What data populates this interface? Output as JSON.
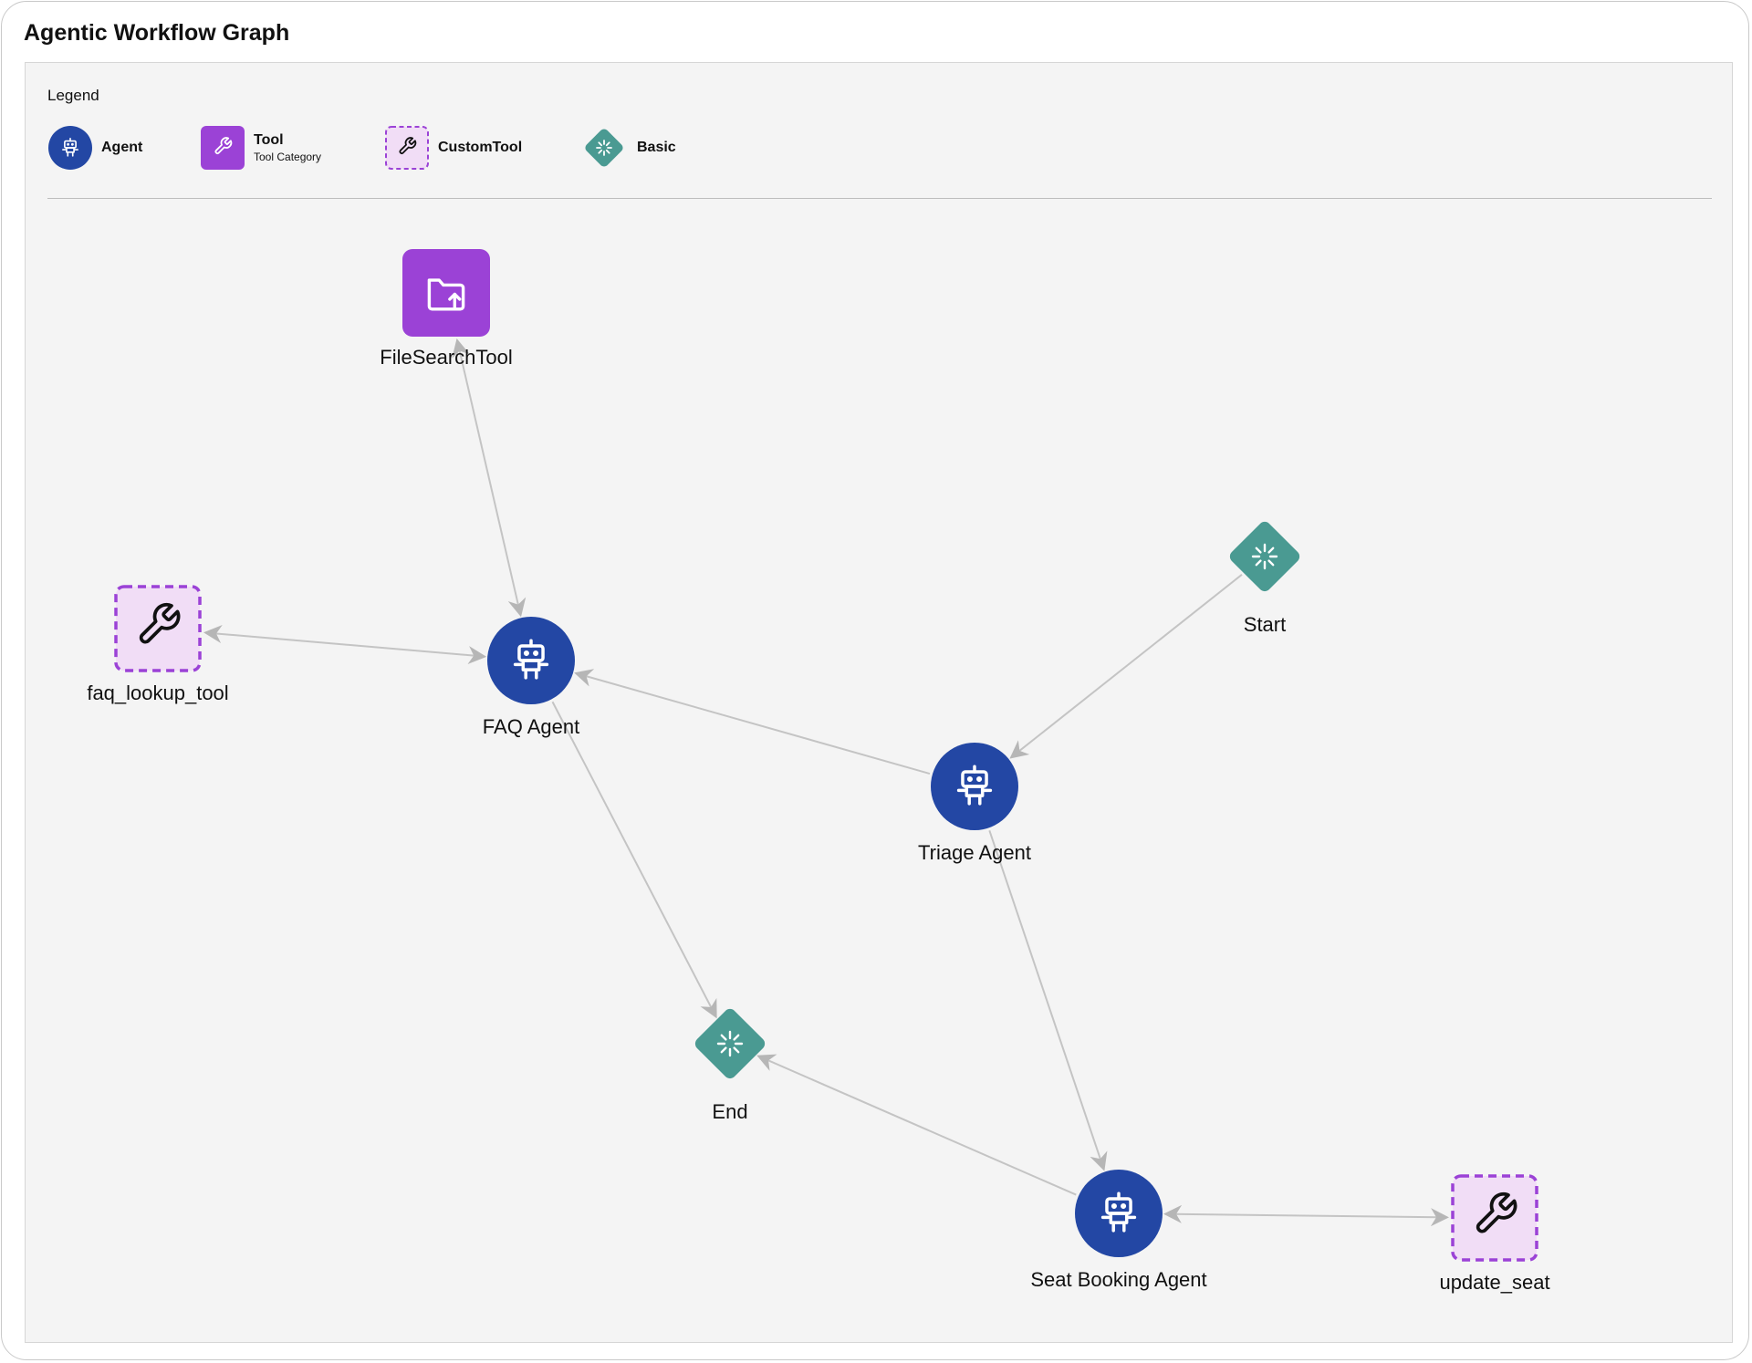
{
  "header": {
    "title": "Agentic Workflow Graph"
  },
  "legend": {
    "title": "Legend",
    "items": [
      {
        "label": "Agent",
        "sublabel": ""
      },
      {
        "label": "Tool",
        "sublabel": "Tool Category"
      },
      {
        "label": "CustomTool",
        "sublabel": ""
      },
      {
        "label": "Basic",
        "sublabel": ""
      }
    ]
  },
  "colors": {
    "agent": "#2347a4",
    "tool": "#9b42d6",
    "custom_tool_fill": "#f1ddf6",
    "custom_tool_border": "#9b42d6",
    "basic": "#4a9a92",
    "edge": "#c4c4c4",
    "arrow": "#b6b6b6"
  },
  "nodes": [
    {
      "id": "filesearch",
      "label": "FileSearchTool",
      "type": "tool",
      "icon": "folder-upload-icon"
    },
    {
      "id": "faq_lookup",
      "label": "faq_lookup_tool",
      "type": "customtool",
      "icon": "wrench-icon"
    },
    {
      "id": "faq_agent",
      "label": "FAQ Agent",
      "type": "agent",
      "icon": "robot-icon"
    },
    {
      "id": "start",
      "label": "Start",
      "type": "basic",
      "icon": "loader-icon"
    },
    {
      "id": "triage",
      "label": "Triage Agent",
      "type": "agent",
      "icon": "robot-icon"
    },
    {
      "id": "end",
      "label": "End",
      "type": "basic",
      "icon": "loader-icon"
    },
    {
      "id": "seat_booking",
      "label": "Seat Booking Agent",
      "type": "agent",
      "icon": "robot-icon"
    },
    {
      "id": "update_seat",
      "label": "update_seat",
      "type": "customtool",
      "icon": "wrench-icon"
    }
  ],
  "edges": [
    {
      "from": "filesearch",
      "to": "faq_agent",
      "bidirectional": true
    },
    {
      "from": "faq_agent",
      "to": "faq_lookup",
      "bidirectional": true
    },
    {
      "from": "start",
      "to": "triage",
      "bidirectional": false
    },
    {
      "from": "triage",
      "to": "faq_agent",
      "bidirectional": false
    },
    {
      "from": "triage",
      "to": "seat_booking",
      "bidirectional": false
    },
    {
      "from": "faq_agent",
      "to": "end",
      "bidirectional": false
    },
    {
      "from": "seat_booking",
      "to": "end",
      "bidirectional": false
    },
    {
      "from": "seat_booking",
      "to": "update_seat",
      "bidirectional": true
    }
  ]
}
